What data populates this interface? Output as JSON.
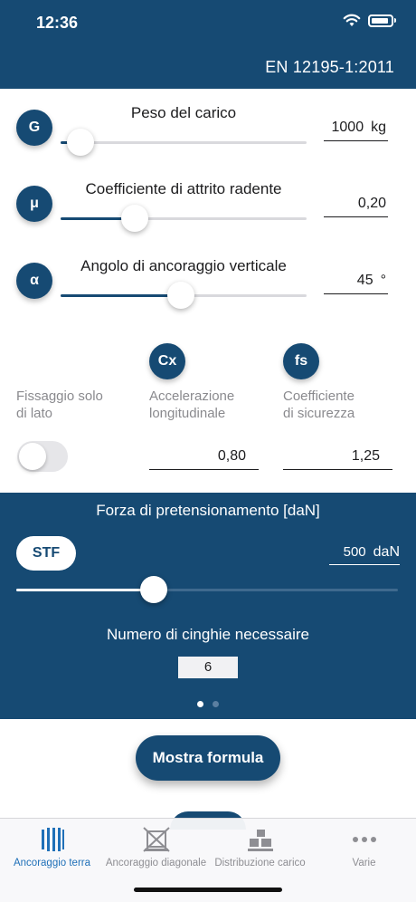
{
  "status_bar": {
    "time": "12:36"
  },
  "header": {
    "standard": "EN 12195-1:2011"
  },
  "rows": [
    {
      "badge": "G",
      "label": "Peso del carico",
      "value": "1000",
      "unit": "kg",
      "slider_fraction": 0.08
    },
    {
      "badge": "μ",
      "label": "Coefficiente di attrito radente",
      "value": "0,20",
      "unit": "",
      "slider_fraction": 0.3
    },
    {
      "badge": "α",
      "label": "Angolo di ancoraggio verticale",
      "value": "45",
      "unit": "°",
      "slider_fraction": 0.49
    }
  ],
  "side_fixing": {
    "label_line1": "Fissaggio solo",
    "label_line2": "di lato",
    "enabled": false
  },
  "cx": {
    "badge": "Cx",
    "label_line1": "Accelerazione",
    "label_line2": "longitudinale",
    "value": "0,80"
  },
  "fs": {
    "badge": "fs",
    "label_line1": "Coefficiente",
    "label_line2": "di sicurezza",
    "value": "1,25"
  },
  "panel": {
    "title": "Forza di pretensionamento [daN]",
    "stf_label": "STF",
    "value": "500",
    "unit": "daN",
    "slider_fraction": 0.36,
    "needed_label": "Numero di cinghie necessaire",
    "needed_value": "6",
    "page_count": 2,
    "active_page": 1
  },
  "buttons": {
    "formula": "Mostra formula"
  },
  "tabbar": {
    "tabs": [
      {
        "label": "Ancoraggio terra",
        "icon": "ground-lashing-icon",
        "active": true
      },
      {
        "label": "Ancoraggio diagonale",
        "icon": "diagonal-lashing-icon",
        "active": false
      },
      {
        "label": "Distribuzione carico",
        "icon": "load-distribution-icon",
        "active": false
      },
      {
        "label": "Varie",
        "icon": "more-icon",
        "active": false
      }
    ]
  },
  "colors": {
    "primary": "#164a73",
    "tab_active": "#1f70b8"
  }
}
